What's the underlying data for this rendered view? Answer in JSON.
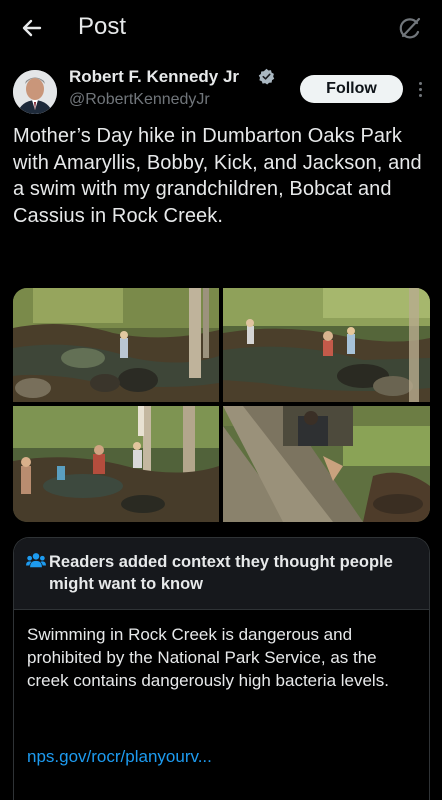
{
  "header": {
    "title": "Post"
  },
  "post": {
    "author_name": "Robert F. Kennedy Jr",
    "author_handle": "@RobertKennedyJr",
    "follow_label": "Follow",
    "text": "Mother’s Day hike in Dumbarton Oaks Park with Amaryllis, Bobby, Kick, and Jackson, and a swim with my grandchildren, Bobcat and Cassius in Rock Creek."
  },
  "community_note": {
    "title": "Readers added context they thought people might want to know",
    "body": "Swimming in Rock Creek is dangerous and prohibited by the National Park Service, as the creek contains dangerously high bacteria levels.",
    "link": "nps.gov/rocr/planyourv..."
  },
  "colors": {
    "background": "#000000",
    "text": "#e7e9ea",
    "secondary_text": "#71767b",
    "accent": "#1d9bf0",
    "note_header": "#16181c",
    "border": "#2f3336"
  },
  "icons": [
    "arrow-left-icon",
    "grok-icon",
    "verified-badge-icon",
    "more-vertical-icon",
    "readers-icon"
  ]
}
